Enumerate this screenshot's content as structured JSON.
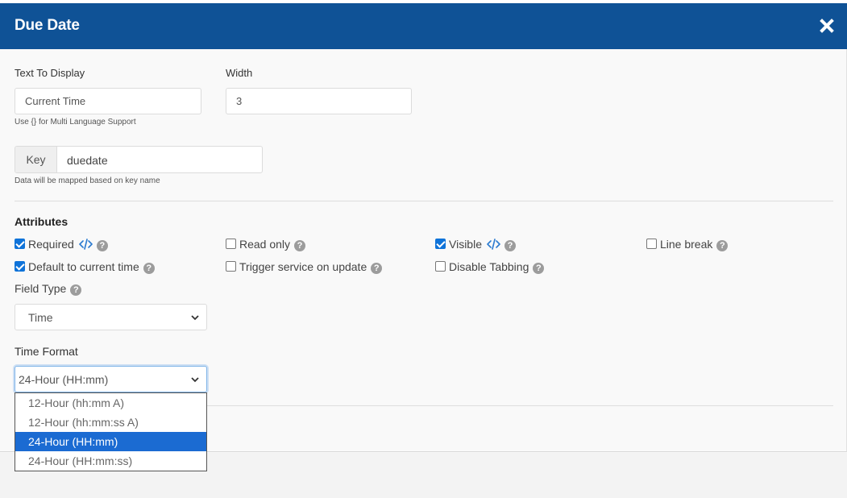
{
  "modal": {
    "title": "Due Date"
  },
  "fields": {
    "text_to_display": {
      "label": "Text To Display",
      "value": "Current Time",
      "hint": "Use {} for Multi Language Support"
    },
    "width": {
      "label": "Width",
      "value": "3"
    },
    "key": {
      "addon": "Key",
      "value": "duedate",
      "hint": "Data will be mapped based on key name"
    }
  },
  "attributes": {
    "title": "Attributes",
    "items": [
      {
        "label": "Required",
        "checked": true,
        "code_icon": true
      },
      {
        "label": "Read only",
        "checked": false
      },
      {
        "label": "Visible",
        "checked": true,
        "code_icon": true
      },
      {
        "label": "Line break",
        "checked": false
      },
      {
        "label": "Default to current time",
        "checked": true
      },
      {
        "label": "Trigger service on update",
        "checked": false
      },
      {
        "label": "Disable Tabbing",
        "checked": false
      }
    ]
  },
  "field_type": {
    "label": "Field Type",
    "value": "Time"
  },
  "time_format": {
    "label": "Time Format",
    "value": "24-Hour (HH:mm)",
    "options": [
      "12-Hour (hh:mm A)",
      "12-Hour (hh:mm:ss A)",
      "24-Hour (HH:mm)",
      "24-Hour (HH:mm:ss)"
    ],
    "selected_index": 2
  },
  "colors": {
    "header": "#0f5296",
    "checkbox_accent": "#0f73d9",
    "dropdown_selected": "#1b6bd2"
  },
  "icons": {
    "close": "close-icon",
    "code": "code-icon",
    "help": "help-icon",
    "chevron": "chevron-down-icon"
  }
}
